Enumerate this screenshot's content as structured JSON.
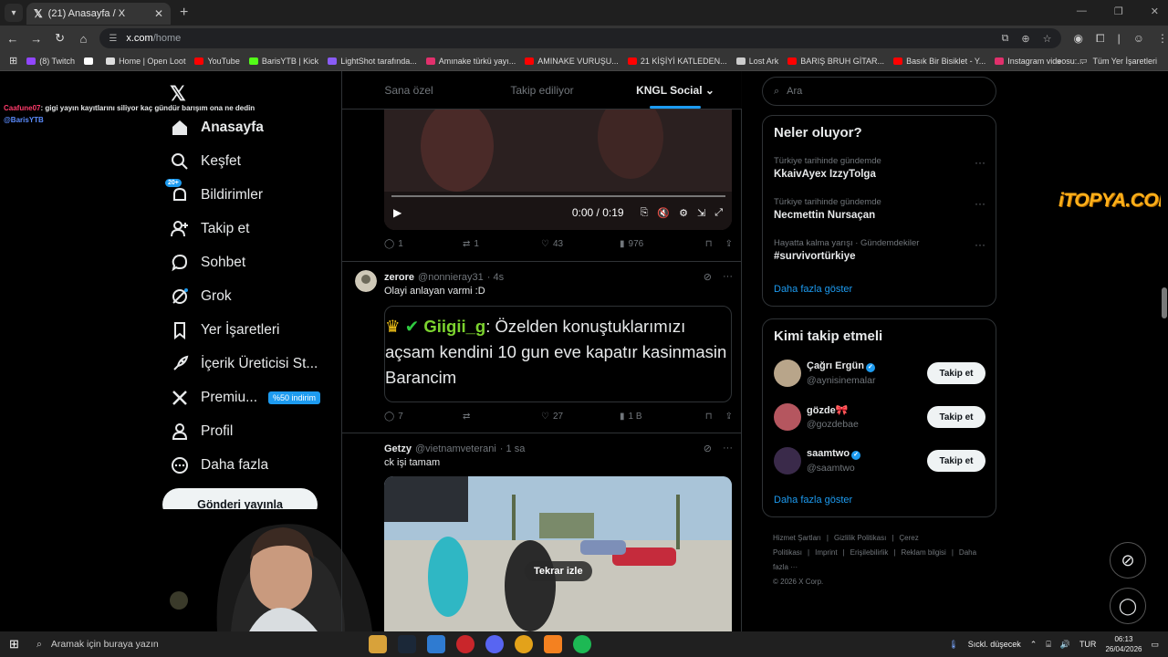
{
  "browser": {
    "tab_title": "(21) Anasayfa / X",
    "url_host": "x.com",
    "url_path": "/home",
    "bookmarks": [
      {
        "label": "(8) Twitch",
        "color": "#9146ff"
      },
      {
        "label": "",
        "color": "#ffffff"
      },
      {
        "label": "Home | Open Loot",
        "color": "#dddddd"
      },
      {
        "label": "YouTube",
        "color": "#ff0000"
      },
      {
        "label": "BarisYTB | Kick",
        "color": "#53fc18"
      },
      {
        "label": "LightShot tarafında...",
        "color": "#8a5cf6"
      },
      {
        "label": "Amınake türkü yayı...",
        "color": "#e1306c"
      },
      {
        "label": "AMINAKE VURUŞU...",
        "color": "#ff0000"
      },
      {
        "label": "21 KİŞİYİ KATLEDEN...",
        "color": "#ff0000"
      },
      {
        "label": "Lost Ark",
        "color": "#cccccc"
      },
      {
        "label": "BARIŞ BRUH GİTAR...",
        "color": "#ff0000"
      },
      {
        "label": "Basık Bir Bisiklet - Y...",
        "color": "#ff0000"
      },
      {
        "label": "Instagram videosu:...",
        "color": "#e1306c"
      }
    ],
    "all_bookmarks_label": "Tüm Yer İşaretleri"
  },
  "chat_overlay": {
    "user": "Caafune07",
    "message": ": gigi yayın kayıtlarını siliyor kaç gündür barışım ona ne dedin",
    "mention": "@BarisYTB"
  },
  "nav": {
    "items": [
      {
        "label": "Anasayfa",
        "icon": "home-icon"
      },
      {
        "label": "Keşfet",
        "icon": "search-icon"
      },
      {
        "label": "Bildirimler",
        "icon": "bell-icon",
        "badge": "20+"
      },
      {
        "label": "Takip et",
        "icon": "follow-icon"
      },
      {
        "label": "Sohbet",
        "icon": "chat-icon"
      },
      {
        "label": "Grok",
        "icon": "grok-icon"
      },
      {
        "label": "Yer İşaretleri",
        "icon": "bookmark-icon"
      },
      {
        "label": "İçerik Üreticisi St...",
        "icon": "rocket-icon"
      },
      {
        "label": "Premiu...",
        "icon": "x-icon",
        "discount": "%50 indirim"
      },
      {
        "label": "Profil",
        "icon": "profile-icon"
      },
      {
        "label": "Daha fazla",
        "icon": "more-icon"
      }
    ],
    "post_button": "Gönderi yayınla"
  },
  "feed": {
    "tabs": [
      "Sana özel",
      "Takip ediliyor",
      "KNGL Social"
    ],
    "video_time": "0:00 / 0:19",
    "post1_actions": {
      "replies": "1",
      "reposts": "1",
      "likes": "43",
      "views": "976"
    },
    "post2": {
      "name": "zerore",
      "handle": "@nonnieray31",
      "time": "· 4s",
      "text": "Olayi anlayan varmi  :D",
      "quote_name": "Giigii_g",
      "quote_text": ": Özelden konuştuklarımızı açsam kendini 10 gun eve kapatır kasinmasin Barancim",
      "replies": "7",
      "reposts": "",
      "likes": "27",
      "views": "1 B"
    },
    "post3": {
      "name": "Getzy",
      "handle": "@vietnamveterani",
      "time": "· 1 sa",
      "text": "ck işi tamam",
      "replay_label": "Tekrar izle"
    }
  },
  "right": {
    "search_placeholder": "Ara",
    "trends_title": "Neler oluyor?",
    "trends": [
      {
        "category": "Türkiye tarihinde gündemde",
        "name": "KkaivAyex IzzyTolga"
      },
      {
        "category": "Türkiye tarihinde gündemde",
        "name": "Necmettin Nursaçan"
      },
      {
        "category": "Hayatta kalma yarışı · Gündemdekiler",
        "name": "#survivortürkiye"
      }
    ],
    "show_more": "Daha fazla göster",
    "who_title": "Kimi takip etmeli",
    "who": [
      {
        "name": "Çağrı Ergün",
        "handle": "@aynisinemalar",
        "verified": true,
        "button": "Takip et"
      },
      {
        "name": "gözde🎀",
        "handle": "@gozdebae",
        "verified": false,
        "button": "Takip et"
      },
      {
        "name": "saamtwo",
        "handle": "@saamtwo",
        "verified": true,
        "button": "Takip et"
      }
    ],
    "footer_links": [
      "Hizmet Şartları",
      "|",
      "Gizlilik Politikası",
      "|",
      "Çerez Politikası",
      "|",
      "Imprint",
      "|",
      "Erişilebilirlik",
      "|",
      "Reklam bilgisi",
      "|",
      "Daha fazla ···"
    ],
    "copyright": "© 2026 X Corp."
  },
  "overlay_brand": "iTOPYA.COM",
  "taskbar": {
    "search_placeholder": "Aramak için buraya yazın",
    "weather": "Sıckl. düşecek",
    "lang": "TUR",
    "time": "06:13",
    "date": "26/04/2026"
  }
}
